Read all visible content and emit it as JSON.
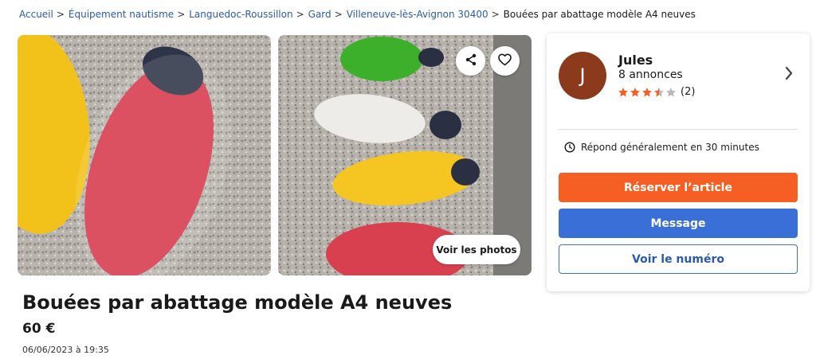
{
  "breadcrumb": {
    "items": [
      "Accueil",
      "Équipement nautisme",
      "Languedoc-Roussillon",
      "Gard",
      "Villeneuve-lès-Avignon 30400"
    ],
    "current": "Bouées par abattage modèle A4 neuves"
  },
  "gallery": {
    "photos_button": "Voir les photos",
    "share_icon": "share-icon",
    "favorite_icon": "heart-icon"
  },
  "listing": {
    "title": "Bouées par abattage modèle A4 neuves",
    "price": "60 €",
    "date": "06/06/2023 à 19:35"
  },
  "seller": {
    "initial": "J",
    "name": "Jules",
    "listings": "8 annonces",
    "rating": 3.5,
    "rating_count": "(2)",
    "response": "Répond généralement en 30 minutes",
    "avatar_color": "#8b3a1c"
  },
  "actions": {
    "reserve": "Réserver l’article",
    "message": "Message",
    "phone": "Voir le numéro"
  },
  "colors": {
    "link": "#2a5aa8",
    "reserve": "#f55f24",
    "message": "#3a6fd8",
    "star": "#f55f24"
  }
}
